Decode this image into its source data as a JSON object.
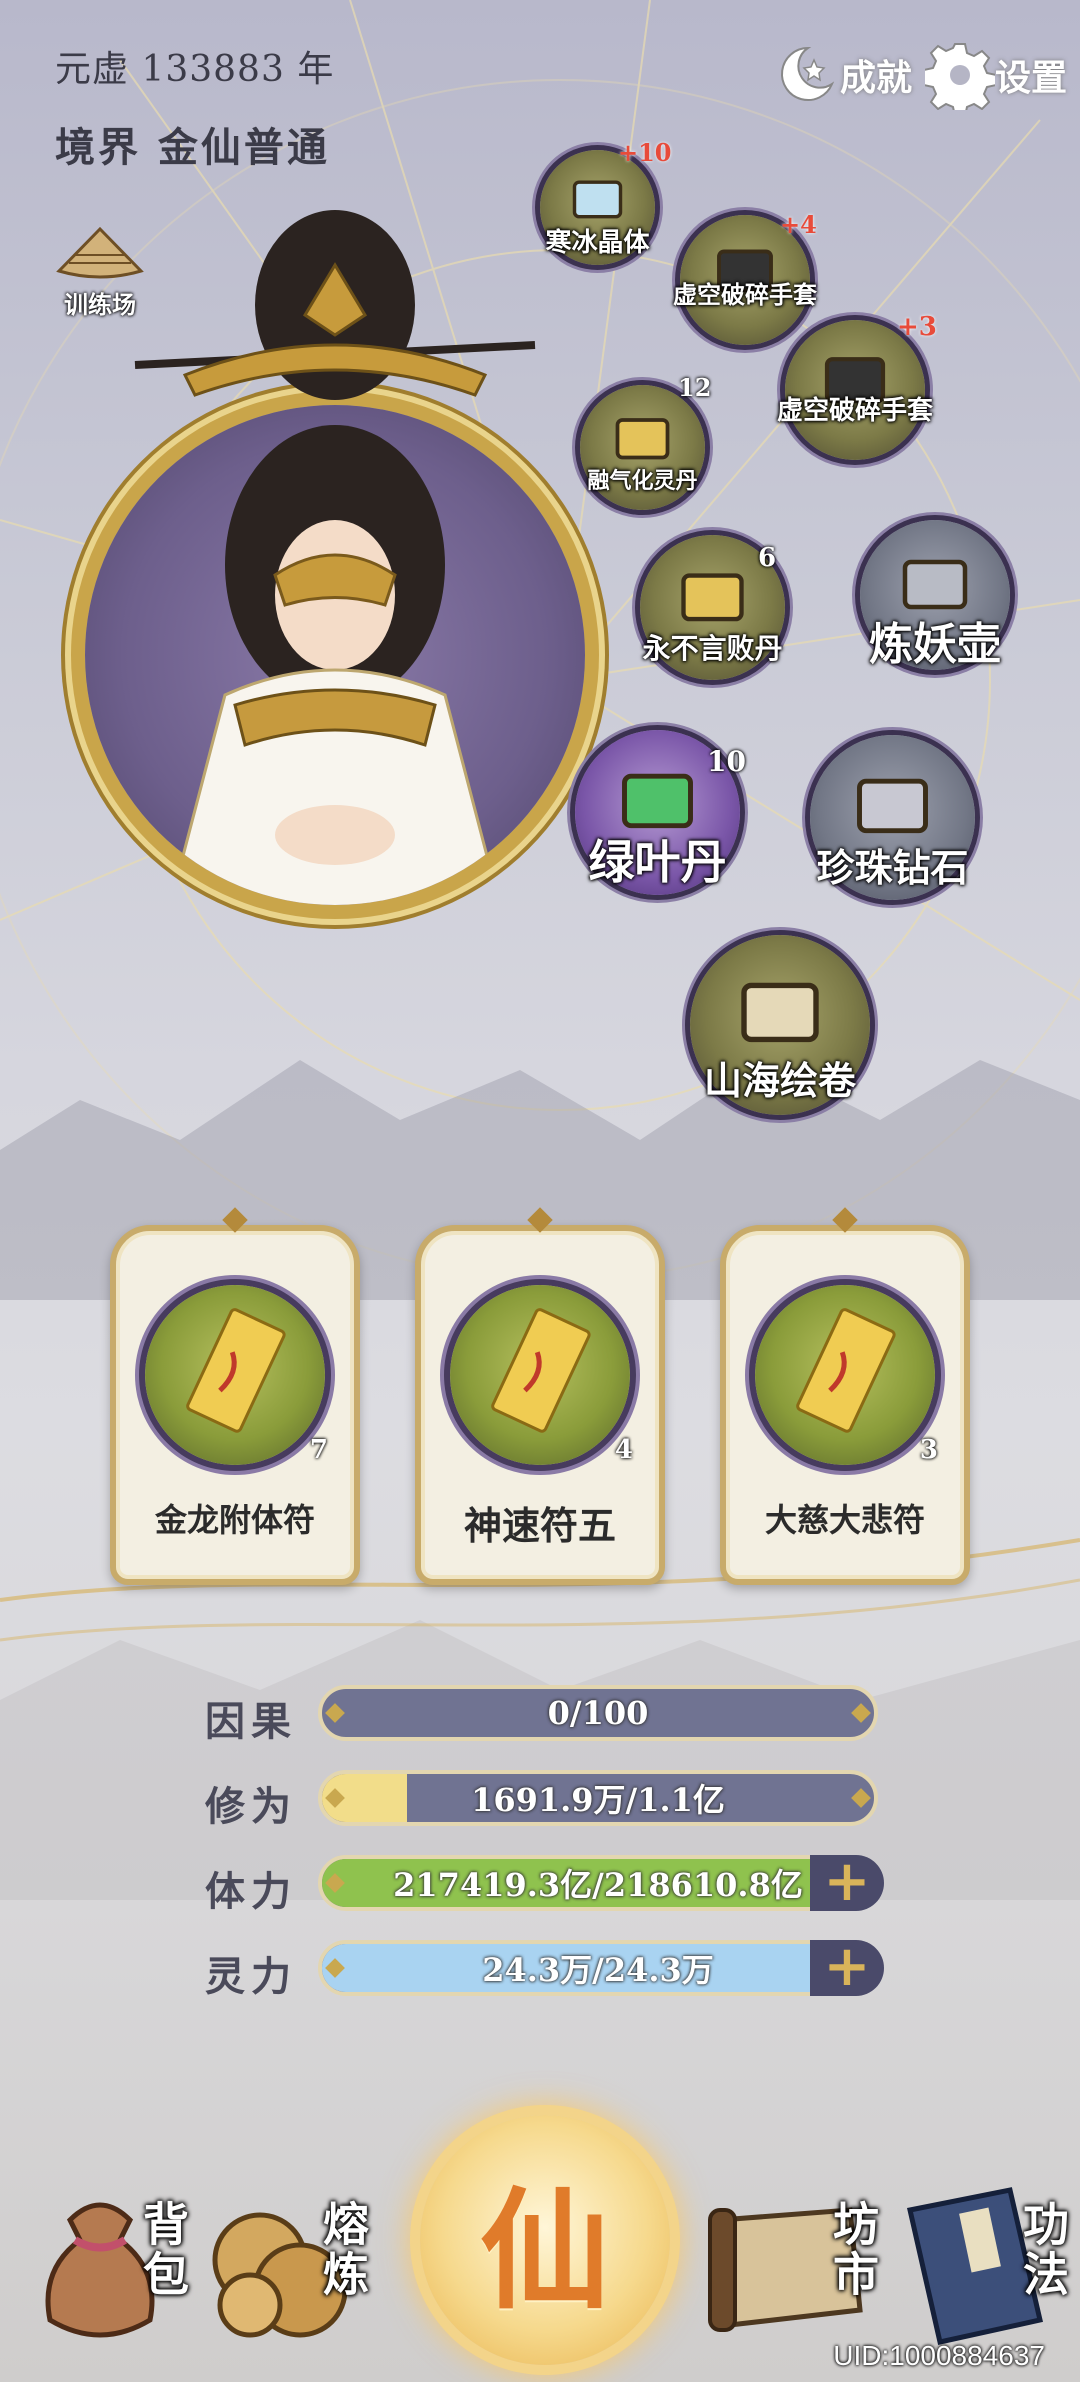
{
  "header": {
    "year": "元虚 133883 年",
    "realm": "境界 金仙普通",
    "achievements_label": "成就",
    "settings_label": "设置"
  },
  "training": {
    "label": "训练场"
  },
  "items": [
    {
      "name": "寒冰晶体",
      "badge": "+10",
      "badge_color": "#e84b3a"
    },
    {
      "name": "虚空破碎手套",
      "badge": "+4",
      "badge_color": "#e84b3a"
    },
    {
      "name": "虚空破碎手套",
      "badge": "+3",
      "badge_color": "#e84b3a"
    },
    {
      "name": "融气化灵丹",
      "badge": "12"
    },
    {
      "name": "永不言败丹",
      "badge": "6"
    },
    {
      "name": "炼妖壶",
      "badge": ""
    },
    {
      "name": "绿叶丹",
      "badge": "10"
    },
    {
      "name": "珍珠钻石",
      "badge": ""
    },
    {
      "name": "山海绘卷",
      "badge": ""
    }
  ],
  "talismans": [
    {
      "name": "金龙附体符",
      "count": "7"
    },
    {
      "name": "神速符五",
      "count": "4"
    },
    {
      "name": "大慈大悲符",
      "count": "3"
    }
  ],
  "stats": [
    {
      "label": "因果",
      "value": "0/100",
      "fill": 0.0,
      "fill_color": "#707392"
    },
    {
      "label": "修为",
      "value": "1691.9万/1.1亿",
      "fill": 0.154,
      "fill_color": "#f2dd8a"
    },
    {
      "label": "体力",
      "value": "217419.3亿/218610.8亿",
      "fill": 0.995,
      "fill_color": "#8fc24e"
    },
    {
      "label": "灵力",
      "value": "24.3万/24.3万",
      "fill": 1.0,
      "fill_color": "#a9d3f1"
    }
  ],
  "nav": {
    "bag": "背包",
    "refine": "熔炼",
    "center": "仙",
    "market": "坊市",
    "skills": "功法"
  },
  "uid": "UID:1000884637"
}
